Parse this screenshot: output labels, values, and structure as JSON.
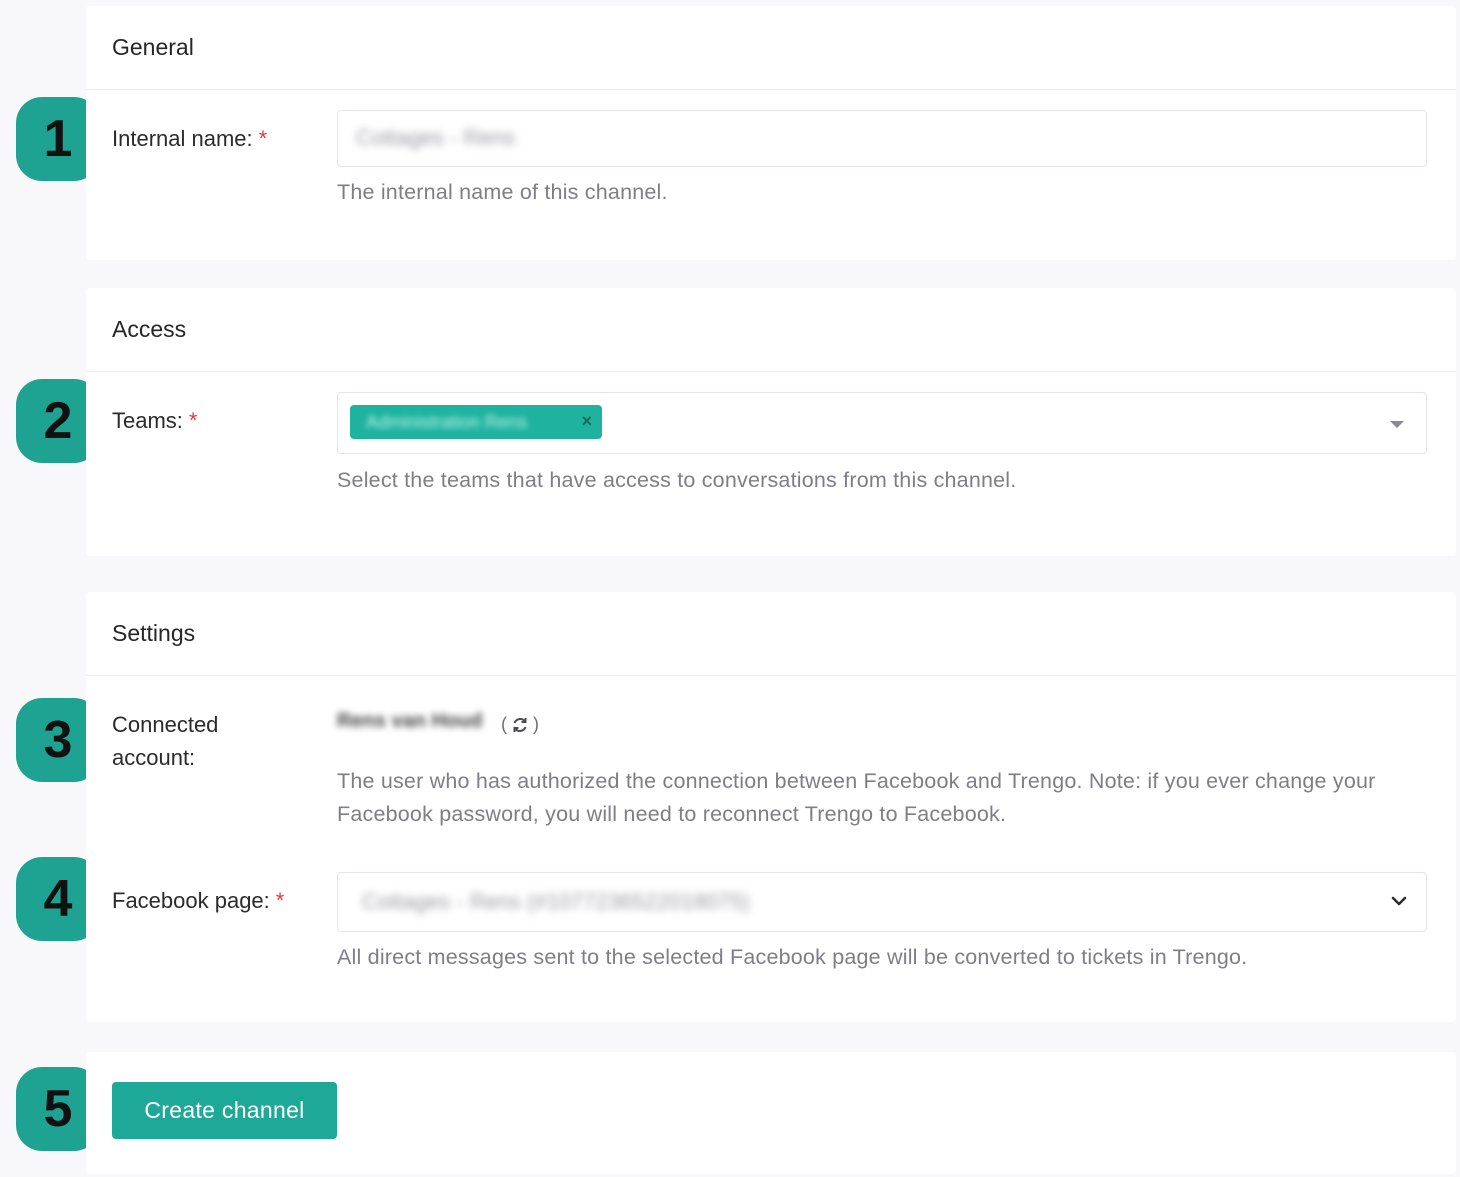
{
  "sections": {
    "general": {
      "title": "General",
      "internal_name": {
        "label": "Internal name:",
        "required": "*",
        "value": "Cottages - Rens",
        "help": "The internal name of this channel."
      }
    },
    "access": {
      "title": "Access",
      "teams": {
        "label": "Teams:",
        "required": "*",
        "selected_tag": "Administration Rens",
        "tag_remove": "×",
        "help": "Select the teams that have access to conversations from this channel."
      }
    },
    "settings": {
      "title": "Settings",
      "connected_account": {
        "label_line1": "Connected",
        "label_line2": "account:",
        "value": "Rens van Houd",
        "refresh_open": "(",
        "refresh_close": ")",
        "help": "The user who has authorized the connection between Facebook and Trengo. Note: if you ever change your Facebook password, you will need to reconnect Trengo to Facebook."
      },
      "facebook_page": {
        "label": "Facebook page:",
        "required": "*",
        "value": "Cottages - Rens (#1077236522018075)",
        "help": "All direct messages sent to the selected Facebook page will be converted to tickets in Trengo."
      }
    }
  },
  "actions": {
    "create_label": "Create channel"
  },
  "steps": [
    "1",
    "2",
    "3",
    "4",
    "5"
  ],
  "colors": {
    "accent": "#1ea898",
    "badge": "#1ea393",
    "required": "#e03a3a"
  }
}
